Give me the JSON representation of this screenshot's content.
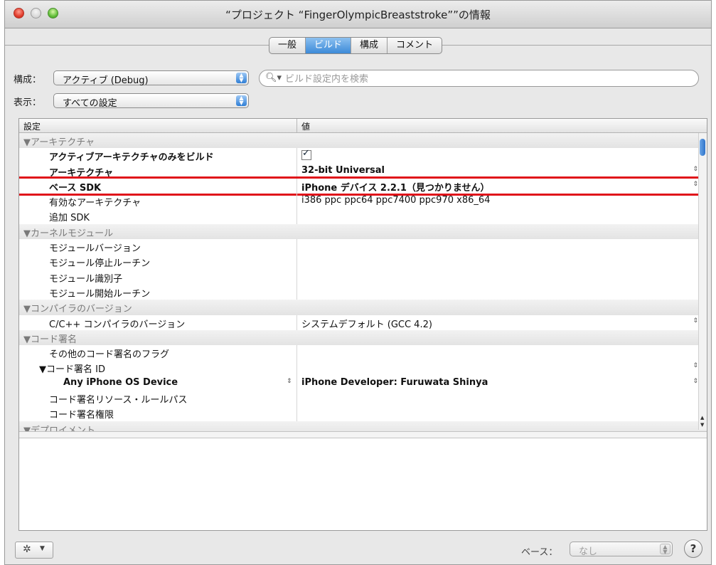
{
  "window": {
    "title": "“プロジェクト “FingerOlympicBreaststroke””の情報"
  },
  "tabs": [
    {
      "label": "一般",
      "active": false
    },
    {
      "label": "ビルド",
      "active": true
    },
    {
      "label": "構成",
      "active": false
    },
    {
      "label": "コメント",
      "active": false
    }
  ],
  "config": {
    "label": "構成：",
    "value": "アクティブ (Debug)"
  },
  "search": {
    "placeholder": "ビルド設定内を検索"
  },
  "show": {
    "label": "表示：",
    "value": "すべての設定"
  },
  "table": {
    "col_setting": "設定",
    "col_value": "値",
    "rows": [
      {
        "type": "group",
        "name": "▼アーキテクチャ",
        "value": ""
      },
      {
        "type": "item",
        "indent": 1,
        "name": "アクティブアーキテクチャのみをビルド",
        "value": "",
        "bold": true,
        "checkbox": true
      },
      {
        "type": "item",
        "indent": 1,
        "name": "アーキテクチャ",
        "value": "32-bit Universal",
        "bold": true,
        "stepper": true
      },
      {
        "type": "item",
        "indent": 1,
        "name": "ベース SDK",
        "value": "iPhone デバイス 2.2.1（見つかりません）",
        "bold": true,
        "stepper": true,
        "highlight": true
      },
      {
        "type": "item",
        "indent": 1,
        "name": "有効なアーキテクチャ",
        "value": "i386 ppc ppc64 ppc7400 ppc970 x86_64"
      },
      {
        "type": "item",
        "indent": 1,
        "name": "追加 SDK",
        "value": ""
      },
      {
        "type": "group",
        "name": "▼カーネルモジュール",
        "value": ""
      },
      {
        "type": "item",
        "indent": 1,
        "name": "モジュールバージョン",
        "value": ""
      },
      {
        "type": "item",
        "indent": 1,
        "name": "モジュール停止ルーチン",
        "value": ""
      },
      {
        "type": "item",
        "indent": 1,
        "name": "モジュール識別子",
        "value": ""
      },
      {
        "type": "item",
        "indent": 1,
        "name": "モジュール開始ルーチン",
        "value": ""
      },
      {
        "type": "group",
        "name": "▼コンパイラのバージョン",
        "value": ""
      },
      {
        "type": "item",
        "indent": 1,
        "name": "C/C++ コンパイラのバージョン",
        "value": "システムデフォルト (GCC 4.2)",
        "stepper": true
      },
      {
        "type": "group",
        "name": "▼コード署名",
        "value": ""
      },
      {
        "type": "item",
        "indent": 1,
        "name": "その他のコード署名のフラグ",
        "value": ""
      },
      {
        "type": "item",
        "indent": 0.5,
        "name": "▼コード署名 ID",
        "value": "",
        "stepper": true
      },
      {
        "type": "item",
        "indent": 2,
        "name": "Any iPhone OS Device",
        "value": "iPhone Developer: Furuwata Shinya",
        "bold": true,
        "stepper": true,
        "name_stepper": true
      },
      {
        "type": "item",
        "indent": 1,
        "name": "コード署名リソース・ルールパス",
        "value": ""
      },
      {
        "type": "item",
        "indent": 1,
        "name": "コード署名権限",
        "value": ""
      },
      {
        "type": "group",
        "name": "▼デプロイメント",
        "value": ""
      }
    ]
  },
  "bottom": {
    "base_label": "ベース：",
    "base_value": "なし",
    "help": "?"
  },
  "icons": {
    "search": "magnifier-icon",
    "gear": "gear-icon",
    "stepper": "stepper-arrows-icon"
  },
  "colors": {
    "highlight_box": "#e0131a",
    "selected_tab": "#3c8ad8"
  }
}
